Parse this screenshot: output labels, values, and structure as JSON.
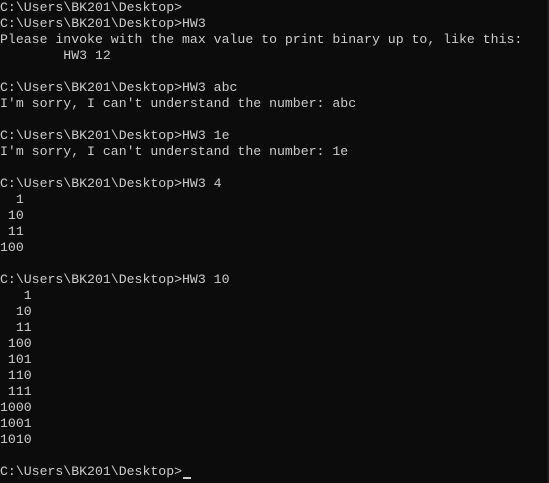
{
  "console": {
    "lines": [
      "C:\\Users\\BK201\\Desktop>",
      "C:\\Users\\BK201\\Desktop>HW3",
      "Please invoke with the max value to print binary up to, like this:",
      "        HW3 12",
      "",
      "C:\\Users\\BK201\\Desktop>HW3 abc",
      "I'm sorry, I can't understand the number: abc",
      "",
      "C:\\Users\\BK201\\Desktop>HW3 1e",
      "I'm sorry, I can't understand the number: 1e",
      "",
      "C:\\Users\\BK201\\Desktop>HW3 4",
      "  1",
      " 10",
      " 11",
      "100",
      "",
      "C:\\Users\\BK201\\Desktop>HW3 10",
      "   1",
      "  10",
      "  11",
      " 100",
      " 101",
      " 110",
      " 111",
      "1000",
      "1001",
      "1010",
      "",
      "C:\\Users\\BK201\\Desktop>"
    ]
  },
  "colors": {
    "background": "#0c0c0c",
    "foreground": "#cccccc"
  }
}
